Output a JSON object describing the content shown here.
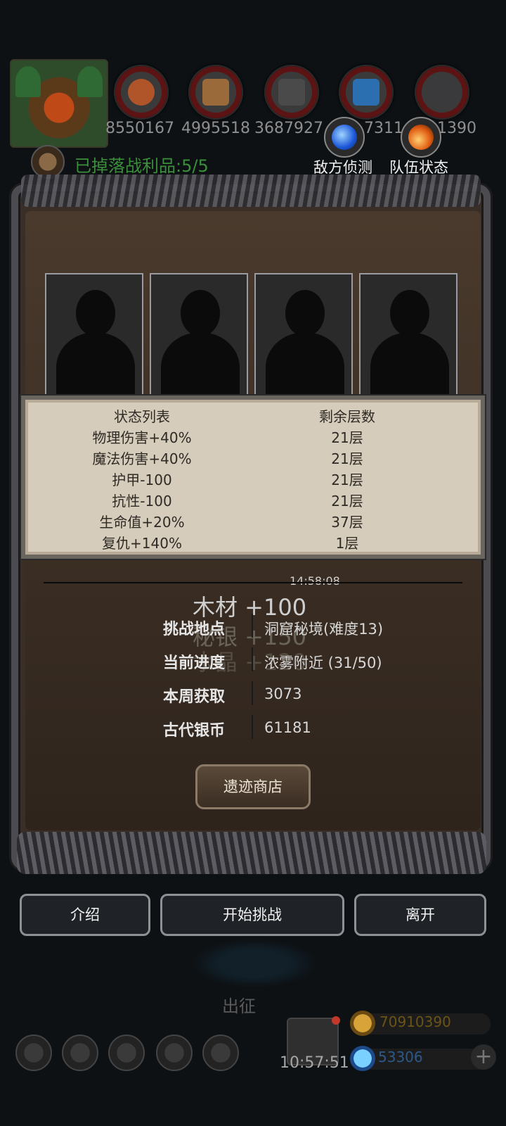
{
  "resources": {
    "values": [
      "8550167",
      "4995518",
      "3687927",
      "7311",
      "1390"
    ],
    "icons": [
      "meat-icon",
      "wood-icon",
      "iron-icon",
      "crystal-icon",
      "stone-icon"
    ]
  },
  "tools": {
    "scout_label": "敌方侦测",
    "team_label": "队伍状态"
  },
  "loot": {
    "text": "已掉落战利品:5/5"
  },
  "status_table": {
    "header_name": "状态列表",
    "header_layers": "剩余层数",
    "rows": [
      {
        "name": "物理伤害+40%",
        "layers": "21层"
      },
      {
        "name": "魔法伤害+40%",
        "layers": "21层"
      },
      {
        "name": "护甲-100",
        "layers": "21层"
      },
      {
        "name": "抗性-100",
        "layers": "21层"
      },
      {
        "name": "生命值+20%",
        "layers": "37层"
      },
      {
        "name": "复仇+140%",
        "layers": "1层"
      }
    ]
  },
  "timer_small": "14:58:08",
  "floating_reward": "木材 +100",
  "floating_ghosts": [
    "秘银 +150",
    "水晶 +120"
  ],
  "info": {
    "location_label": "挑战地点",
    "location_value": "洞窟秘境(难度13)",
    "progress_label": "当前进度",
    "progress_value": "浓雾附近 (31/50)",
    "weekly_label": "本周获取",
    "weekly_value": "3073",
    "coin_label": "古代银币",
    "coin_value": "61181"
  },
  "buttons": {
    "shop": "遗迹商店",
    "intro": "介绍",
    "start": "开始挑战",
    "leave": "离开"
  },
  "bottom": {
    "expedition": "出征",
    "clock": "10:57:51",
    "gold": "70910390",
    "gems": "53306",
    "plus": "+"
  },
  "colors": {
    "loot_green": "#3b8f3b",
    "parchment": "#d6ccbb",
    "frame_metal": "#4b4b50"
  }
}
